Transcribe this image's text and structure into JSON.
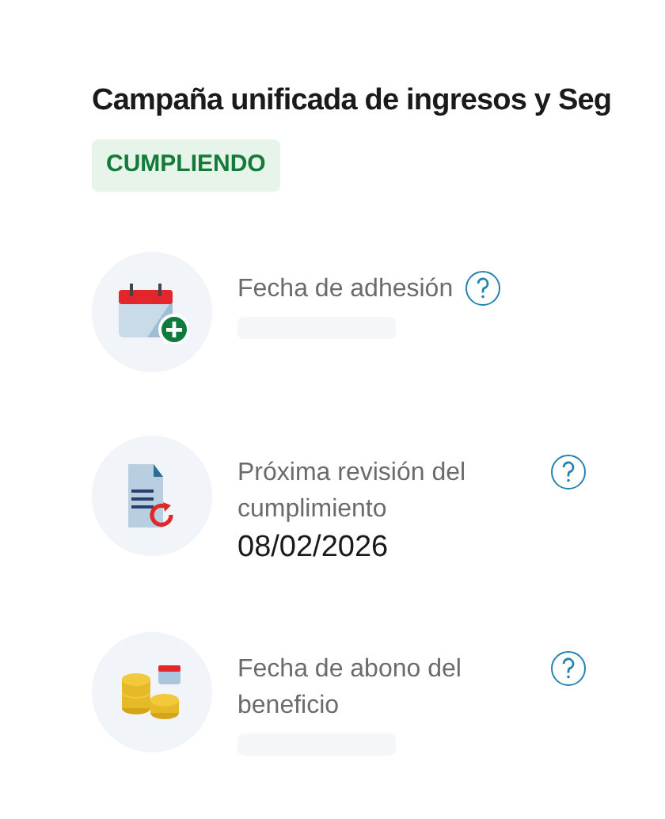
{
  "title": "Campaña unificada de ingresos y Seg",
  "status_badge": "CUMPLIENDO",
  "items": [
    {
      "kind": "calendar",
      "label": "Fecha de adhesión",
      "value": null,
      "loading": true
    },
    {
      "kind": "document",
      "label": "Próxima revisión del cumplimiento",
      "value": "08/02/2026",
      "loading": false
    },
    {
      "kind": "coins",
      "label": "Fecha de abono del beneficio",
      "value": null,
      "loading": true
    }
  ]
}
